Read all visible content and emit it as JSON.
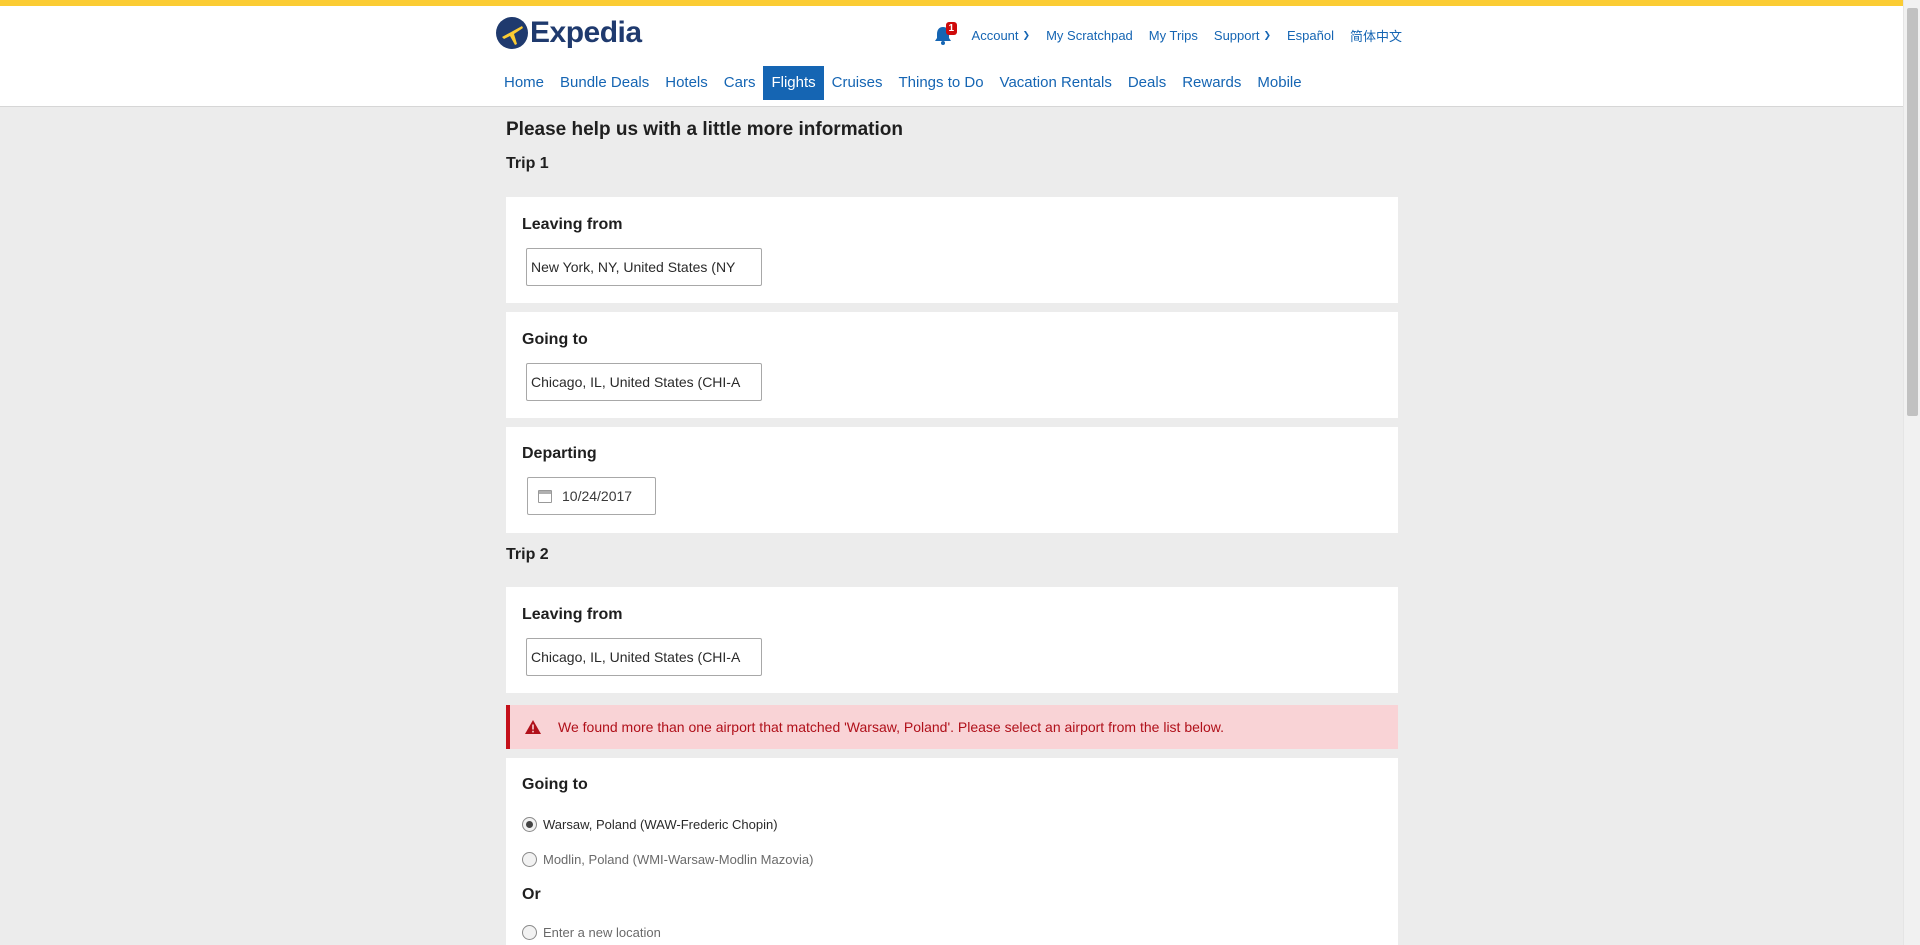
{
  "header": {
    "logo_text": "Expedia",
    "notification_count": "1",
    "util_links": [
      "Account",
      "My Scratchpad",
      "My Trips",
      "Support",
      "Español",
      "简体中文"
    ],
    "nav": [
      "Home",
      "Bundle Deals",
      "Hotels",
      "Cars",
      "Flights",
      "Cruises",
      "Things to Do",
      "Vacation Rentals",
      "Deals",
      "Rewards",
      "Mobile"
    ],
    "active_nav": "Flights"
  },
  "page_title": "Please help us with a little more information",
  "trip1": {
    "label": "Trip 1",
    "leaving_from": {
      "label": "Leaving from",
      "value": "New York, NY, United States (NY"
    },
    "going_to": {
      "label": "Going to",
      "value": "Chicago, IL, United States (CHI-A"
    },
    "departing": {
      "label": "Departing",
      "value": "10/24/2017"
    }
  },
  "trip2": {
    "label": "Trip 2",
    "leaving_from": {
      "label": "Leaving from",
      "value": "Chicago, IL, United States (CHI-A"
    },
    "alert": "We found more than one airport that matched 'Warsaw, Poland'. Please select an airport from the list below.",
    "going_to": {
      "label": "Going to",
      "options": [
        {
          "label": "Warsaw, Poland (WAW-Frederic Chopin)",
          "checked": true
        },
        {
          "label": "Modlin, Poland (WMI-Warsaw-Modlin Mazovia)",
          "checked": false
        }
      ],
      "or_label": "Or",
      "new_location_label": "Enter a new location"
    }
  },
  "colors": {
    "brand": "#1f3a6e",
    "link": "#1565b3",
    "stripe": "#fbcc33",
    "alert_bg": "#f9d3d6",
    "alert_text": "#b0101a"
  }
}
